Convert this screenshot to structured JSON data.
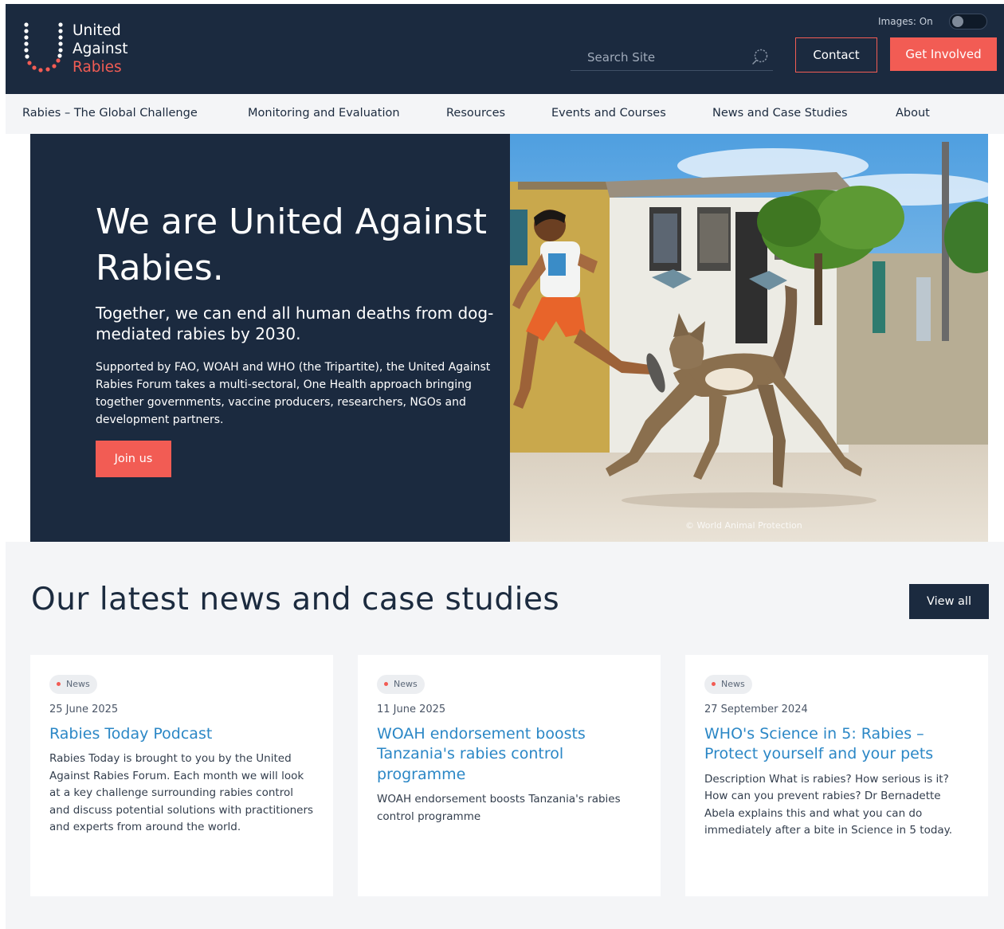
{
  "header": {
    "logo": {
      "line1": "United",
      "line2": "Against",
      "line3": "Rabies"
    },
    "images_toggle_label": "Images: On",
    "search_placeholder": "Search Site",
    "contact_label": "Contact",
    "get_involved_label": "Get Involved"
  },
  "nav": {
    "items": [
      "Rabies – The Global Challenge",
      "Monitoring and Evaluation",
      "Resources",
      "Events and Courses",
      "News and Case Studies",
      "About"
    ]
  },
  "hero": {
    "title": "We are United Against Rabies.",
    "subtitle": "Together, we can end all human deaths from dog-mediated rabies by 2030.",
    "body": "Supported by FAO, WOAH and WHO (the Tripartite), the United Against Rabies Forum takes a multi-sectoral, One Health approach bringing together governments, vaccine producers, researchers, NGOs and development partners.",
    "cta_label": "Join us",
    "photo_credit": "© World Animal Protection"
  },
  "news": {
    "heading": "Our latest news and case studies",
    "view_all_label": "View all",
    "cards": [
      {
        "tag": "News",
        "date": "25 June 2025",
        "title": "Rabies Today Podcast",
        "description": "Rabies Today is brought to you by the United Against Rabies Forum. Each month we will look at a key challenge surrounding rabies control and discuss potential solutions with practitioners and experts from around the world."
      },
      {
        "tag": "News",
        "date": "11 June 2025",
        "title": "WOAH endorsement boosts Tanzania's rabies control programme",
        "description": "WOAH endorsement boosts Tanzania's rabies control programme"
      },
      {
        "tag": "News",
        "date": "27 September 2024",
        "title": "WHO's Science in 5: Rabies – Protect yourself and your pets",
        "description": "Description What is rabies? How serious is it? How can you prevent rabies? Dr Bernadette Abela explains this and what you can do immediately after a bite in Science in 5 today."
      }
    ]
  },
  "colors": {
    "navy": "#1b2a3f",
    "coral": "#f25c54",
    "link_blue": "#2b87c6",
    "light_gray": "#f4f5f7"
  }
}
